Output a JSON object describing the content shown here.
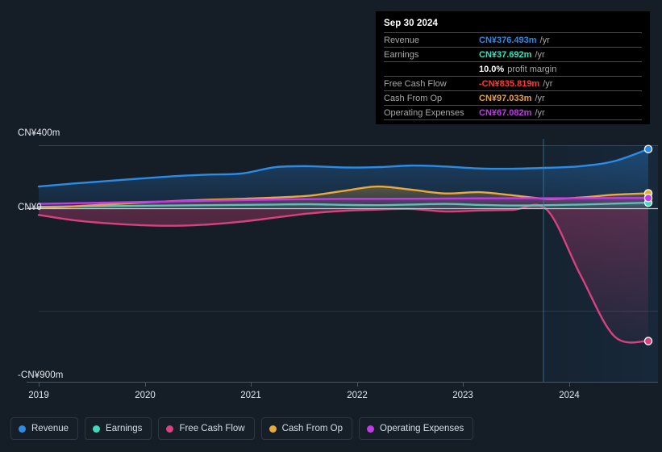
{
  "chart_data": {
    "type": "area",
    "title": "",
    "xlabel": "",
    "ylabel": "",
    "currency": "CN¥",
    "units": "m",
    "ylim": [
      -900,
      400
    ],
    "grid": true,
    "gridlines": [
      400,
      0,
      -400,
      -900
    ],
    "y_tick_labels": [
      "CN¥400m",
      "CN¥0",
      "-CN¥900m"
    ],
    "x_tick_labels": [
      "2019",
      "2020",
      "2021",
      "2022",
      "2023",
      "2024"
    ],
    "x_range": [
      "2018-10",
      "2025-03"
    ],
    "forecast_divider_x": "2023-09",
    "legend_position": "bottom",
    "categories": [
      "2018-11",
      "2019-03",
      "2019-07",
      "2019-11",
      "2020-03",
      "2020-07",
      "2020-11",
      "2021-03",
      "2021-07",
      "2021-11",
      "2022-03",
      "2022-07",
      "2022-11",
      "2023-03",
      "2023-07",
      "2023-11",
      "2024-03",
      "2024-07",
      "2024-09"
    ],
    "series": [
      {
        "name": "Revenue",
        "color": "#2b8ce8",
        "values": [
          140,
          158,
          174,
          190,
          205,
          215,
          222,
          262,
          268,
          260,
          262,
          272,
          266,
          254,
          252,
          258,
          268,
          300,
          376
        ]
      },
      {
        "name": "Earnings",
        "color": "#3ddbb8",
        "values": [
          12,
          14,
          16,
          18,
          20,
          22,
          24,
          26,
          28,
          24,
          22,
          26,
          30,
          24,
          20,
          22,
          26,
          32,
          38
        ]
      },
      {
        "name": "Free Cash Flow",
        "color": "#d6417f",
        "values": [
          -40,
          -72,
          -92,
          -104,
          -108,
          -100,
          -82,
          -56,
          -30,
          -14,
          -6,
          -2,
          -18,
          -12,
          -8,
          -6,
          -420,
          -806,
          -836
        ]
      },
      {
        "name": "Cash From Op",
        "color": "#e8a93d",
        "values": [
          4,
          14,
          26,
          38,
          48,
          56,
          62,
          70,
          82,
          112,
          140,
          120,
          96,
          104,
          84,
          62,
          70,
          88,
          97
        ]
      },
      {
        "name": "Operating Expenses",
        "color": "#c23be8",
        "values": [
          30,
          34,
          38,
          42,
          46,
          50,
          54,
          58,
          60,
          62,
          62,
          63,
          64,
          65,
          66,
          66,
          66,
          67,
          67
        ]
      }
    ]
  },
  "tooltip": {
    "date": "Sep 30 2024",
    "rows": [
      {
        "label": "Revenue",
        "value": "CN¥376.493m",
        "suffix": "/yr",
        "color": "#2b8ce8"
      },
      {
        "label": "Earnings",
        "value": "CN¥37.692m",
        "suffix": "/yr",
        "color": "#2ee6c0"
      },
      {
        "label": "",
        "value": "10.0%",
        "suffix": "profit margin",
        "color": "#ffffff"
      },
      {
        "label": "Free Cash Flow",
        "value": "-CN¥835.819m",
        "suffix": "/yr",
        "color": "#ff3b30"
      },
      {
        "label": "Cash From Op",
        "value": "CN¥97.033m",
        "suffix": "/yr",
        "color": "#e8a33d"
      },
      {
        "label": "Operating Expenses",
        "value": "CN¥67.082m",
        "suffix": "/yr",
        "color": "#c23be8"
      }
    ]
  },
  "legend": {
    "items": [
      {
        "label": "Revenue",
        "color": "#2b8ce8"
      },
      {
        "label": "Earnings",
        "color": "#3ddbb8"
      },
      {
        "label": "Free Cash Flow",
        "color": "#d6417f"
      },
      {
        "label": "Cash From Op",
        "color": "#e8a93d"
      },
      {
        "label": "Operating Expenses",
        "color": "#c23be8"
      }
    ]
  },
  "axes": {
    "y_top": "CN¥400m",
    "y_zero": "CN¥0",
    "y_bottom": "-CN¥900m",
    "x_ticks": [
      "2019",
      "2020",
      "2021",
      "2022",
      "2023",
      "2024"
    ]
  }
}
